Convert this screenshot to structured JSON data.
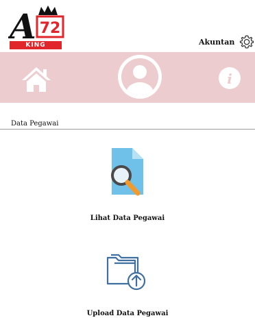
{
  "header": {
    "logo": {
      "number": "72",
      "letter": "A",
      "banner_text": "KING"
    },
    "account_label": "Akuntan"
  },
  "navbar": {
    "items": [
      {
        "name": "home",
        "icon": "home-icon"
      },
      {
        "name": "profile",
        "icon": "user-avatar-icon"
      },
      {
        "name": "info",
        "icon": "info-icon"
      }
    ]
  },
  "colors": {
    "navbar_bg": "#ecccce",
    "logo_red": "#e0262b",
    "doc_blue": "#6fc1ea",
    "magnifier_orange": "#f39a2c",
    "folder_blue": "#3f6f9e"
  },
  "main": {
    "section_title": "Data Pegawai",
    "actions": [
      {
        "label": "Lihat Data Pegawai",
        "icon": "view-document-icon"
      },
      {
        "label": "Upload Data Pegawai",
        "icon": "folder-upload-icon"
      }
    ]
  }
}
